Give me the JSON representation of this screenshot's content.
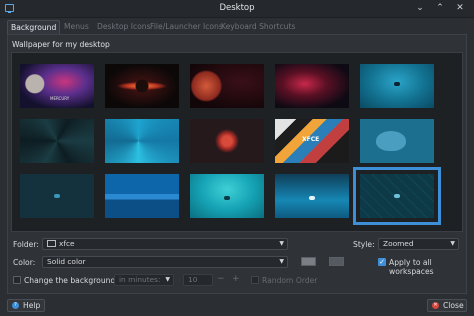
{
  "window": {
    "title": "Desktop",
    "controls": [
      "minimize-icon",
      "maximize-icon",
      "close-icon"
    ]
  },
  "tabs": [
    {
      "label": "Background",
      "active": true
    },
    {
      "label": "Menus",
      "active": false
    },
    {
      "label": "Desktop Icons",
      "active": false
    },
    {
      "label": "File/Launcher Icons",
      "active": false
    },
    {
      "label": "Keyboard Shortcuts",
      "active": false
    }
  ],
  "wallpaper": {
    "section_label": "Wallpaper for my desktop",
    "thumbnails": [
      {
        "name": "galaxy-planet",
        "caption": "MERCURY",
        "selected": false
      },
      {
        "name": "saturn-rings",
        "caption": "",
        "selected": false
      },
      {
        "name": "red-planet",
        "caption": "",
        "selected": false
      },
      {
        "name": "nebula-dark",
        "caption": "",
        "selected": false
      },
      {
        "name": "blue-gradient-mouse",
        "caption": "",
        "selected": false
      },
      {
        "name": "dark-fan",
        "caption": "",
        "selected": false
      },
      {
        "name": "blue-swirl",
        "caption": "",
        "selected": false
      },
      {
        "name": "red-flower",
        "caption": "",
        "selected": false
      },
      {
        "name": "xfce-cubes",
        "caption": "XFCE",
        "selected": false
      },
      {
        "name": "mouse-illustration",
        "caption": "",
        "selected": false
      },
      {
        "name": "dark-blue-mouse",
        "caption": "",
        "selected": false
      },
      {
        "name": "stripes-blue",
        "caption": "",
        "selected": false
      },
      {
        "name": "teal-gradient",
        "caption": "",
        "selected": false
      },
      {
        "name": "blue-gradient-2",
        "caption": "",
        "selected": false
      },
      {
        "name": "diamond-pattern",
        "caption": "",
        "selected": true
      }
    ]
  },
  "controls": {
    "folder_label": "Folder:",
    "folder_value": "xfce",
    "folder_icon": "folder-icon",
    "style_label": "Style:",
    "style_value": "Zoomed",
    "color_label": "Color:",
    "color_value": "Solid color",
    "color1": "#7a7f86",
    "color2": "#555a61",
    "apply_all_label": "Apply to all workspaces",
    "apply_all_checked": true,
    "change_bg_label": "Change the background",
    "change_bg_checked": false,
    "interval_unit": "in minutes:",
    "interval_value": "10",
    "minus": "−",
    "plus": "+",
    "random_label": "Random Order",
    "random_checked": false
  },
  "footer": {
    "help_label": "Help",
    "close_label": "Close",
    "help_icon": "help-icon",
    "close_icon": "close-icon"
  },
  "colors": {
    "accent": "#3d8fd8",
    "window_bg": "#2b2e33",
    "titlebar": "#25282c"
  }
}
